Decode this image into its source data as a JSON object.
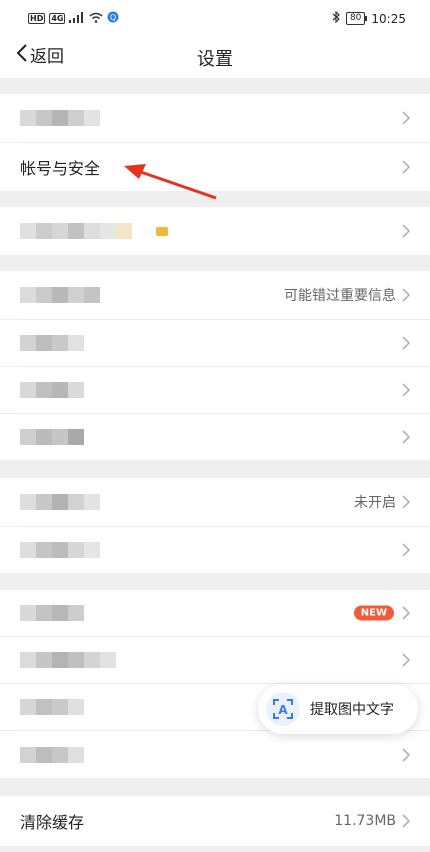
{
  "status": {
    "left_tags": [
      "HD",
      "4G"
    ],
    "battery": "80",
    "time": "10:25"
  },
  "nav": {
    "back_label": "返回",
    "title": "设置"
  },
  "rows": {
    "account_security": "帐号与安全",
    "miss_info_value": "可能错过重要信息",
    "not_enabled_value": "未开启",
    "new_badge": "NEW",
    "clear_cache_label": "清除缓存",
    "clear_cache_value": "11.73MB"
  },
  "ocr": {
    "label": "提取图中文字",
    "icon_letter": "A"
  },
  "colors": {
    "accent_red": "#f15a3a",
    "ocr_blue": "#3b7be8",
    "annotation_arrow": "#e8321e"
  }
}
